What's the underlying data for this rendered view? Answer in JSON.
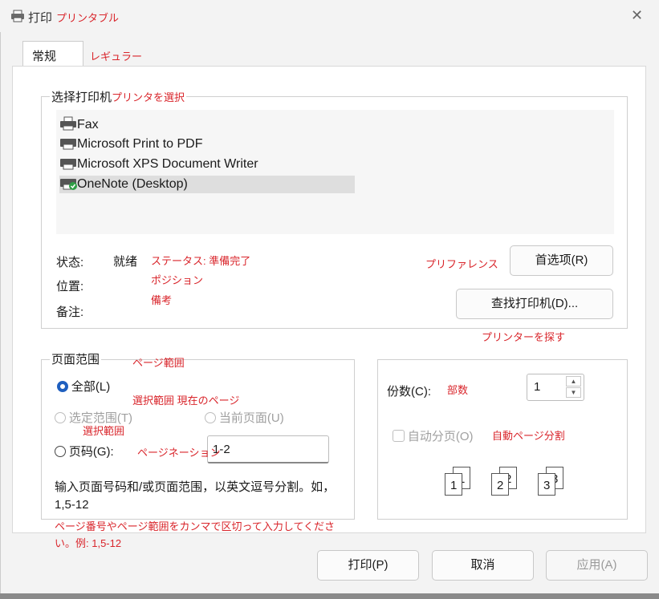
{
  "window": {
    "title": "打印",
    "title_annotation": "プリンタブル",
    "close_glyph": "✕"
  },
  "tabs": [
    {
      "label": "常规",
      "annotation": "レギュラー"
    }
  ],
  "select_printer": {
    "legend": "选择打印机",
    "legend_annotation": "プリンタを選択",
    "printers": [
      {
        "name": "Fax",
        "icon": "fax-printer-icon"
      },
      {
        "name": "Microsoft Print to PDF",
        "icon": "printer-icon"
      },
      {
        "name": "Microsoft XPS Document Writer",
        "icon": "printer-icon"
      },
      {
        "name": "OneNote (Desktop)",
        "icon": "default-printer-icon",
        "selected": true
      }
    ],
    "status_label": "状态:",
    "status_value": "就绪",
    "status_annotation": "ステータス: 準備完了",
    "location_label": "位置:",
    "location_annotation": "ポジション",
    "comment_label": "备注:",
    "comment_annotation": "備考",
    "preferences_annotation": "プリファレンス",
    "preferences_button": "首选项(R)",
    "find_printer_button": "查找打印机(D)...",
    "find_printer_annotation": "プリンターを探す"
  },
  "page_range": {
    "legend": "页面范围",
    "legend_annotation": "ページ範囲",
    "all_label": "全部(L)",
    "selection_annotation": "選択範囲 現在のページ",
    "selection_label": "选定范围(T)",
    "current_page_label": "当前页面(U)",
    "selection_annotation2": "選択範囲",
    "pages_label": "页码(G):",
    "pages_annotation": "ページネーション",
    "pages_value": "1-2",
    "hint": "输入页面号码和/或页面范围，以英文逗号分割。如，1,5-12",
    "hint_annotation": "ページ番号やページ範囲をカンマで区切って入力してください。例: 1,5-12"
  },
  "copies": {
    "label": "份数(C):",
    "annotation": "部数",
    "value": "1",
    "collate_label": "自动分页(O)",
    "collate_annotation": "自動ページ分割",
    "collate_checked": false,
    "collate_pages": [
      "1",
      "1",
      "2",
      "2",
      "3",
      "3"
    ]
  },
  "buttons": {
    "print": "打印(P)",
    "cancel": "取消",
    "apply": "应用(A)"
  }
}
